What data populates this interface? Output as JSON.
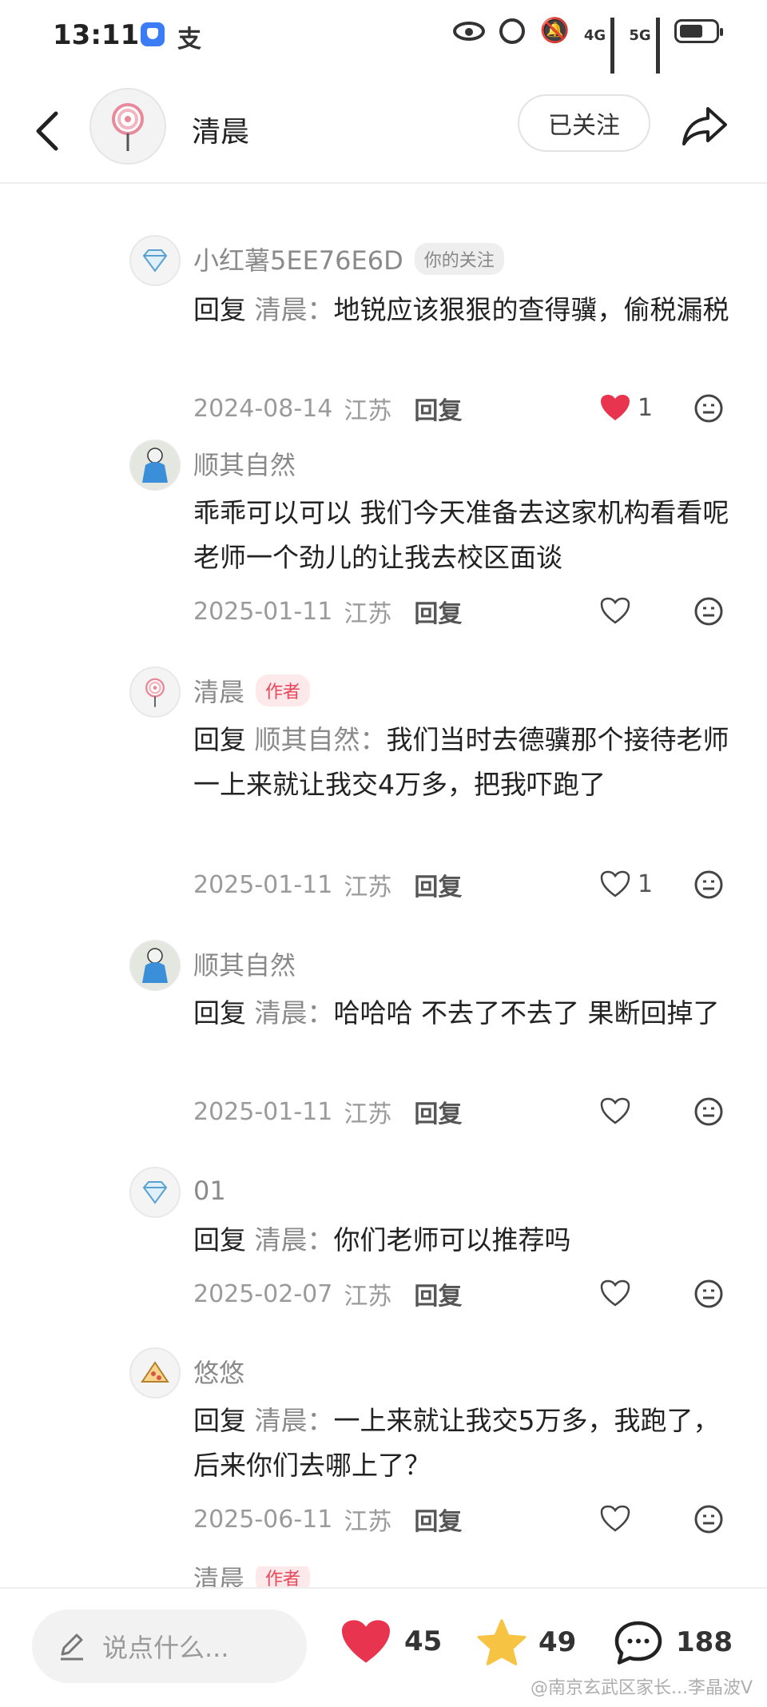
{
  "status_bar": {
    "time": "13:11",
    "app_icon_2": "支",
    "network": [
      "4G",
      "5G"
    ]
  },
  "header": {
    "user_name": "清晨",
    "follow_label": "已关注"
  },
  "comments": [
    {
      "name": "小红薯5EE76E6D",
      "tag": "你的关注",
      "tag_type": "follow",
      "avatar_icon": "diamond-icon",
      "reply_prefix": "回复",
      "reply_target": "清晨：",
      "text": "地锐应该狠狠的查得骥，偷税漏税",
      "date": "2024-08-14",
      "location": "江苏",
      "reply_label": "回复",
      "likes": "1",
      "liked": true
    },
    {
      "name": "顺其自然",
      "tag": "",
      "tag_type": "",
      "avatar_icon": "child-photo-avatar",
      "reply_prefix": "",
      "reply_target": "",
      "text": "乖乖可以可以 我们今天准备去这家机构看看呢 老师一个劲儿的让我去校区面谈",
      "date": "2025-01-11",
      "location": "江苏",
      "reply_label": "回复",
      "likes": "",
      "liked": false
    },
    {
      "name": "清晨",
      "tag": "作者",
      "tag_type": "author",
      "avatar_icon": "lollipop-icon",
      "reply_prefix": "回复",
      "reply_target": "顺其自然：",
      "text": "我们当时去德骥那个接待老师一上来就让我交4万多，把我吓跑了",
      "date": "2025-01-11",
      "location": "江苏",
      "reply_label": "回复",
      "likes": "1",
      "liked": false
    },
    {
      "name": "顺其自然",
      "tag": "",
      "tag_type": "",
      "avatar_icon": "child-photo-avatar",
      "reply_prefix": "回复",
      "reply_target": "清晨：",
      "text": "哈哈哈 不去了不去了 果断回掉了",
      "date": "2025-01-11",
      "location": "江苏",
      "reply_label": "回复",
      "likes": "",
      "liked": false
    },
    {
      "name": "01",
      "tag": "",
      "tag_type": "",
      "avatar_icon": "diamond-icon",
      "reply_prefix": "回复",
      "reply_target": "清晨：",
      "text": "你们老师可以推荐吗",
      "date": "2025-02-07",
      "location": "江苏",
      "reply_label": "回复",
      "likes": "",
      "liked": false
    },
    {
      "name": "悠悠",
      "tag": "",
      "tag_type": "",
      "avatar_icon": "pizza-icon",
      "reply_prefix": "回复",
      "reply_target": "清晨：",
      "text": "一上来就让我交5万多，我跑了，后来你们去哪上了？",
      "date": "2025-06-11",
      "location": "江苏",
      "reply_label": "回复",
      "likes": "",
      "liked": false
    }
  ],
  "partial_comment": {
    "name": "清晨",
    "tag": "作者"
  },
  "bottom_bar": {
    "input_placeholder": "说点什么...",
    "likes": "45",
    "favorites": "49",
    "comments": "188",
    "watermark": "@南京玄武区家长...李晶波V"
  },
  "colors": {
    "like_red": "#e8344e",
    "star_yellow": "#f6c343",
    "author_tag": "#e8475b"
  }
}
